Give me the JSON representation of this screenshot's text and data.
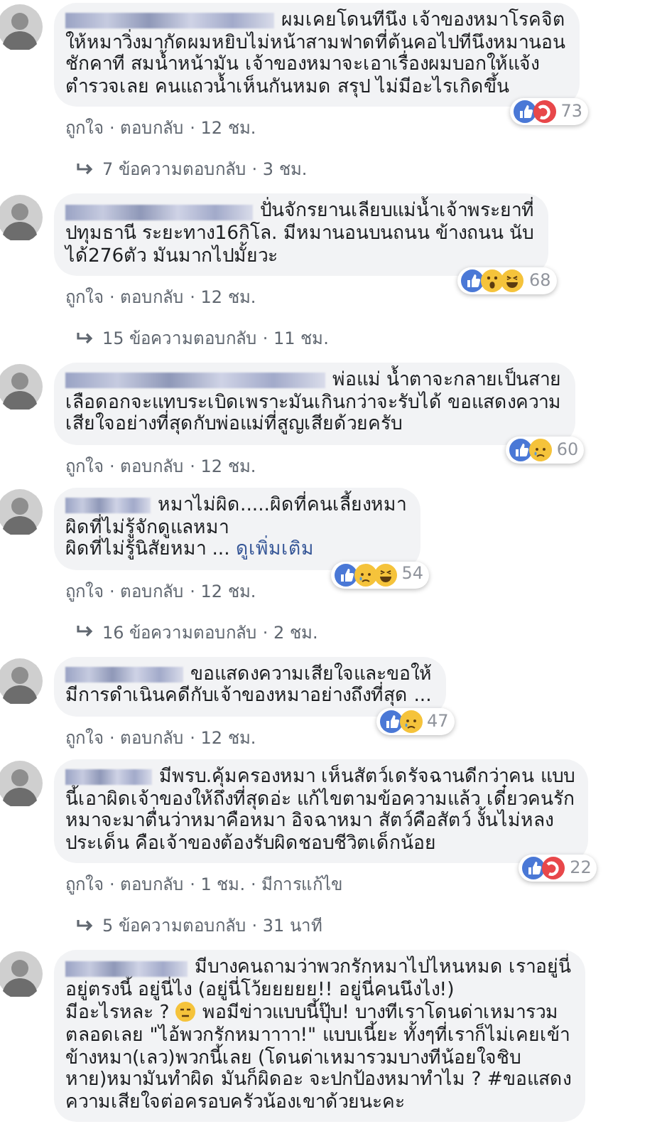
{
  "comments": [
    {
      "lead": "ผมเคยโดนทีนึง เจ้าของหมาโรคจิต",
      "body": [
        {
          "kind": "text",
          "text": "ให้หมาวิ่งมากัดผมหยิบไม่หน้าสามฟาดที่ต้นคอไปทีนึงหมานอน\nชักคาที สมน้ำหน้ามัน เจ้าของหมาจะเอาเรื่องผมบอกให้แจ้ง\nตำรวจเลย คนแถวน้ำเห็นกันหมด สรุป ไม่มีอะไรเกิดขึ้น"
        }
      ],
      "reactions": [
        {
          "kind": "like"
        },
        {
          "kind": "love"
        }
      ],
      "count": "73",
      "actions": [
        "ถูกใจ",
        "· ตอบกลับ",
        "· 12 ชม."
      ],
      "replies": "7 ข้อความตอบกลับ · 3 ชม."
    },
    {
      "lead": "ปั่นจักรยานเลียบแม่น้ำเจ้าพระยาที่",
      "body": [
        {
          "kind": "text",
          "text": "ปทุมธานี ระยะทาง16กิโล. มีหมานอนบนถนน ข้างถนน นับ\nได้276ตัว มันมากไปมั้ยวะ"
        }
      ],
      "reactions": [
        {
          "kind": "like"
        },
        {
          "kind": "wow"
        },
        {
          "kind": "haha"
        }
      ],
      "count": "68",
      "actions": [
        "ถูกใจ",
        "· ตอบกลับ",
        "· 12 ชม."
      ],
      "replies": "15 ข้อความตอบกลับ · 11 ชม."
    },
    {
      "lead": "พ่อแม่ น้ำตาจะกลายเป็นสาย",
      "body": [
        {
          "kind": "text",
          "text": "เลือดอกจะแทบระเบิดเพราะมันเกินกว่าจะรับได้ ขอแสดงความ\nเสียใจอย่างที่สุดกับพ่อแม่ที่สูญเสียด้วยครับ"
        }
      ],
      "reactions": [
        {
          "kind": "like"
        },
        {
          "kind": "sad"
        }
      ],
      "count": "60",
      "actions": [
        "ถูกใจ",
        "· ตอบกลับ",
        "· 12 ชม."
      ]
    },
    {
      "lead": "หมาไม่ผิด.....ผิดที่คนเลี้ยงหมา",
      "body": [
        {
          "kind": "text",
          "text": "ผิดที่ไม่รู้จักดูแลหมา\nผิดที่ไม่รู้นิสัยหมา ... "
        },
        {
          "kind": "link",
          "text": "ดูเพิ่มเติม"
        }
      ],
      "reactions": [
        {
          "kind": "like"
        },
        {
          "kind": "sad"
        },
        {
          "kind": "haha"
        }
      ],
      "count": "54",
      "actions": [
        "ถูกใจ",
        "· ตอบกลับ",
        "· 12 ชม."
      ],
      "replies": "16 ข้อความตอบกลับ · 2 ชม."
    },
    {
      "lead": "ขอแสดงความเสียใจและขอให้",
      "body": [
        {
          "kind": "text",
          "text": "มีการดำเนินคดีกับเจ้าของหมาอย่างถึงที่สุด ..."
        }
      ],
      "reactions": [
        {
          "kind": "like"
        },
        {
          "kind": "sad"
        }
      ],
      "count": "47",
      "actions": [
        "ถูกใจ",
        "· ตอบกลับ",
        "· 12 ชม."
      ]
    },
    {
      "lead": "มีพรบ.คุ้มครองหมา เห็นสัตว์เดรัจฉานดีกว่าคน แบบ",
      "body": [
        {
          "kind": "text",
          "text": "นี้เอาผิดเจ้าของให้ถึงที่สุดอ่ะ แก้ไขตามข้อความแล้ว เดี๋ยวคนรัก\nหมาจะมาตื่นว่าหมาคือหมา อิจฉาหมา สัตว์คือสัตว์ งั้นไม่หลง\nประเด็น คือเจ้าของต้องรับผิดชอบชีวิตเด็กน้อย"
        }
      ],
      "reactions": [
        {
          "kind": "like"
        },
        {
          "kind": "love"
        }
      ],
      "count": "22",
      "actions": [
        "ถูกใจ",
        "· ตอบกลับ",
        "· 1 ชม.",
        "· มีการแก้ไข"
      ],
      "replies": "5 ข้อความตอบกลับ · 31 นาที"
    },
    {
      "lead": "มีบางคนถามว่าพวกรักหมาไปไหนหมด เราอยู่นี่",
      "body": [
        {
          "kind": "text",
          "text": "อยู่ตรงนี้ อยู่นี่ไง (อยู่นี่โว้ยยยยย!! อยู่นี่คนนึงไง!)\nมีอะไรหละ ? "
        },
        {
          "kind": "emoji"
        },
        {
          "kind": "text",
          "text": " พอมีข่าวแบบนี้ปุ๊บ! บางทีเราโดนด่าเหมารวม\nตลอดเลย \"ไอ้พวกรักหมาาาา!\" แบบเนี้ยะ ทั้งๆที่เราก็ไม่เคยเข้า\nข้างหมา(เลว)พวกนี้เลย (โดนด่าเหมารวมบางทีน้อยใจชิบ\nหาย)หมามันทำผิด มันก็ผิดอะ จะปกป้องหมาทำไม ? #ขอแสดง\nความเสียใจต่อครอบครัวน้องเขาด้วยนะคะ"
        }
      ]
    }
  ]
}
